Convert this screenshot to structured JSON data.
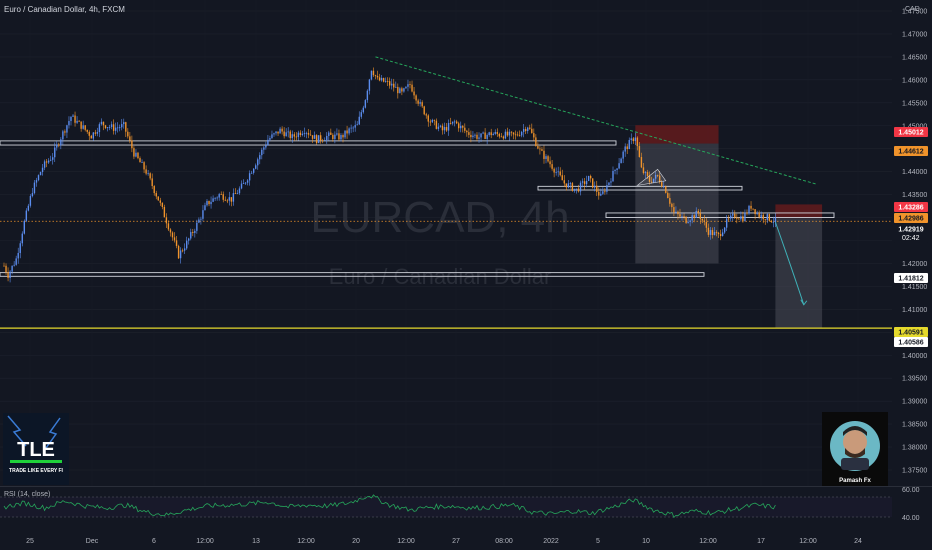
{
  "header": {
    "title": "Euro / Canadian Dollar, 4h, FXCM",
    "currency": "CAD"
  },
  "watermark": {
    "symbol": "EURCAD, 4h",
    "name": "Euro / Canadian Dollar"
  },
  "logos": {
    "left": "TLE",
    "left_sub": "TRADE LIKE EVERY FI",
    "right_caption": "Pamash Fx"
  },
  "rsi": {
    "label": "RSI (14, close)",
    "upper": "60.00",
    "lower": "40.00"
  },
  "colors": {
    "bg": "#131722",
    "bull": "#5b8def",
    "bear": "#f0932b",
    "grid": "#1e222d",
    "trend": "#26a65b",
    "yellow_line": "#e5d92c",
    "rsi_line": "#26a65b",
    "target_arrow": "#3fb1b8",
    "stop_zone": "#6e1c1c",
    "profit_zone": "#4a4d57"
  },
  "chart_data": {
    "type": "candlestick",
    "symbol": "EURCAD",
    "timeframe": "4h",
    "source": "FXCM",
    "y_axis": {
      "ticks": [
        "1.47500",
        "1.47000",
        "1.46500",
        "1.46000",
        "1.45500",
        "1.45000",
        "1.44500",
        "1.44000",
        "1.43500",
        "1.43000",
        "1.42500",
        "1.42000",
        "1.41500",
        "1.41000",
        "1.40500",
        "1.40000",
        "1.39500",
        "1.39000",
        "1.38500",
        "1.38000",
        "1.37500"
      ],
      "range": [
        1.373,
        1.479
      ]
    },
    "x_axis": {
      "ticks": [
        "25",
        "Dec",
        "6",
        "12:00",
        "13",
        "12:00",
        "20",
        "12:00",
        "27",
        "08:00",
        "2022",
        "5",
        "10",
        "12:00",
        "17",
        "12:00",
        "24"
      ]
    },
    "price_labels": [
      {
        "value": "1.45012",
        "color": "#f23645",
        "text_color": "#ffffff"
      },
      {
        "value": "1.44612",
        "color": "#f0932b",
        "text_color": "#131722"
      },
      {
        "value": "1.43286",
        "color": "#f23645",
        "text_color": "#ffffff"
      },
      {
        "value": "1.42986",
        "color": "#f0932b",
        "text_color": "#131722"
      },
      {
        "value": "1.42919",
        "countdown": "02:42",
        "color": "#131722",
        "text_color": "#ffffff"
      },
      {
        "value": "1.41812",
        "color": "#ffffff",
        "text_color": "#131722"
      },
      {
        "value": "1.40591",
        "color": "#e5d92c",
        "text_color": "#131722"
      },
      {
        "value": "1.40586",
        "color": "#ffffff",
        "text_color": "#131722"
      }
    ],
    "close_anchors": [
      [
        0,
        1.4195
      ],
      [
        2,
        1.4175
      ],
      [
        6,
        1.421
      ],
      [
        10,
        1.429
      ],
      [
        14,
        1.436
      ],
      [
        19,
        1.441
      ],
      [
        24,
        1.4435
      ],
      [
        28,
        1.4475
      ],
      [
        33,
        1.452
      ],
      [
        38,
        1.45
      ],
      [
        43,
        1.4478
      ],
      [
        48,
        1.4505
      ],
      [
        54,
        1.4495
      ],
      [
        59,
        1.45
      ],
      [
        64,
        1.444
      ],
      [
        70,
        1.44
      ],
      [
        76,
        1.434
      ],
      [
        82,
        1.427
      ],
      [
        86,
        1.4218
      ],
      [
        90,
        1.4245
      ],
      [
        95,
        1.4285
      ],
      [
        100,
        1.433
      ],
      [
        106,
        1.435
      ],
      [
        112,
        1.434
      ],
      [
        118,
        1.4372
      ],
      [
        124,
        1.442
      ],
      [
        130,
        1.447
      ],
      [
        136,
        1.449
      ],
      [
        142,
        1.4475
      ],
      [
        148,
        1.4492
      ],
      [
        154,
        1.447
      ],
      [
        160,
        1.4478
      ],
      [
        166,
        1.4475
      ],
      [
        170,
        1.449
      ],
      [
        174,
        1.45
      ],
      [
        178,
        1.456
      ],
      [
        181,
        1.4625
      ],
      [
        184,
        1.46
      ],
      [
        188,
        1.4595
      ],
      [
        192,
        1.4585
      ],
      [
        196,
        1.457
      ],
      [
        200,
        1.459
      ],
      [
        205,
        1.4545
      ],
      [
        210,
        1.451
      ],
      [
        216,
        1.449
      ],
      [
        222,
        1.4508
      ],
      [
        228,
        1.4485
      ],
      [
        234,
        1.4475
      ],
      [
        240,
        1.4483
      ],
      [
        246,
        1.448
      ],
      [
        252,
        1.4478
      ],
      [
        258,
        1.45
      ],
      [
        264,
        1.4445
      ],
      [
        270,
        1.4412
      ],
      [
        276,
        1.4375
      ],
      [
        282,
        1.436
      ],
      [
        288,
        1.4385
      ],
      [
        294,
        1.4345
      ],
      [
        300,
        1.4395
      ],
      [
        306,
        1.445
      ],
      [
        311,
        1.4478
      ],
      [
        314,
        1.4405
      ],
      [
        318,
        1.438
      ],
      [
        322,
        1.439
      ],
      [
        326,
        1.436
      ],
      [
        330,
        1.431
      ],
      [
        336,
        1.4295
      ],
      [
        342,
        1.431
      ],
      [
        347,
        1.427
      ],
      [
        352,
        1.426
      ],
      [
        356,
        1.429
      ],
      [
        360,
        1.4305
      ],
      [
        364,
        1.43
      ],
      [
        368,
        1.4325
      ],
      [
        372,
        1.4305
      ],
      [
        376,
        1.43
      ],
      [
        380,
        1.4292
      ]
    ],
    "rsi_anchors": [
      [
        0,
        50
      ],
      [
        10,
        54
      ],
      [
        20,
        49
      ],
      [
        30,
        56
      ],
      [
        40,
        51
      ],
      [
        50,
        49
      ],
      [
        60,
        52
      ],
      [
        70,
        45
      ],
      [
        80,
        42
      ],
      [
        90,
        47
      ],
      [
        100,
        51
      ],
      [
        110,
        52
      ],
      [
        120,
        53
      ],
      [
        130,
        55
      ],
      [
        140,
        50
      ],
      [
        150,
        52
      ],
      [
        160,
        51
      ],
      [
        170,
        54
      ],
      [
        180,
        62
      ],
      [
        190,
        52
      ],
      [
        200,
        47
      ],
      [
        210,
        50
      ],
      [
        220,
        51
      ],
      [
        230,
        49
      ],
      [
        240,
        50
      ],
      [
        250,
        52
      ],
      [
        260,
        45
      ],
      [
        270,
        43
      ],
      [
        280,
        46
      ],
      [
        290,
        44
      ],
      [
        300,
        50
      ],
      [
        310,
        57
      ],
      [
        320,
        47
      ],
      [
        330,
        42
      ],
      [
        340,
        46
      ],
      [
        350,
        44
      ],
      [
        360,
        48
      ],
      [
        370,
        52
      ],
      [
        380,
        50
      ]
    ],
    "horizontal_zones": [
      {
        "top": 1.4467,
        "bottom": 1.4458
      },
      {
        "top": 1.418,
        "bottom": 1.4172
      },
      {
        "top": 1.4368,
        "bottom": 1.436
      },
      {
        "top": 1.431,
        "bottom": 1.43
      }
    ],
    "trendline": {
      "from": [
        183,
        1.465
      ],
      "to": [
        400,
        1.4373
      ]
    },
    "level_line": 1.40591,
    "current_price_line": 1.42919,
    "positions": [
      {
        "kind": "short-1",
        "entry": 1.44612,
        "stop": 1.45012,
        "target": 1.42,
        "from_bar": 311,
        "to_bar": 352
      },
      {
        "kind": "short-2",
        "entry": 1.42986,
        "stop": 1.43286,
        "target": 1.40591,
        "from_bar": 380,
        "to_bar": 403
      }
    ]
  }
}
